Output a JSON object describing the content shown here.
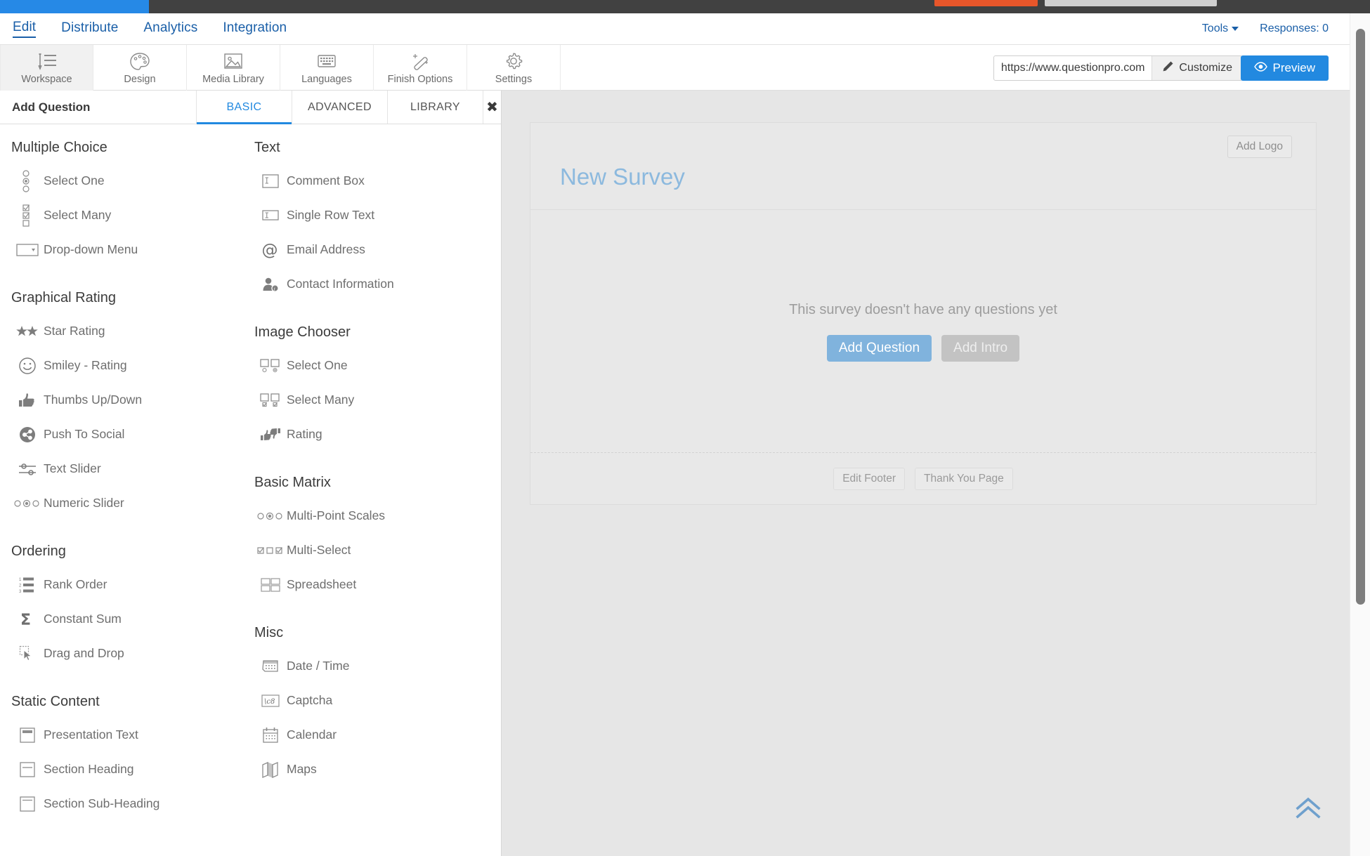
{
  "nav": {
    "tabs": [
      {
        "label": "Edit",
        "active": true
      },
      {
        "label": "Distribute",
        "active": false
      },
      {
        "label": "Analytics",
        "active": false
      },
      {
        "label": "Integration",
        "active": false
      }
    ],
    "tools_label": "Tools",
    "responses_label": "Responses: 0"
  },
  "toolbar": {
    "items": [
      {
        "label": "Workspace",
        "icon": "workspace-icon",
        "active": true
      },
      {
        "label": "Design",
        "icon": "palette-icon",
        "active": false
      },
      {
        "label": "Media Library",
        "icon": "image-icon",
        "active": false
      },
      {
        "label": "Languages",
        "icon": "keyboard-icon",
        "active": false
      },
      {
        "label": "Finish Options",
        "icon": "magic-wand-icon",
        "active": false
      },
      {
        "label": "Settings",
        "icon": "gear-icon",
        "active": false
      }
    ],
    "url_value": "https://www.questionpro.com",
    "customize_label": "Customize",
    "preview_label": "Preview"
  },
  "question_panel": {
    "title": "Add Question",
    "tabs": [
      {
        "label": "BASIC",
        "active": true
      },
      {
        "label": "ADVANCED",
        "active": false
      },
      {
        "label": "LIBRARY",
        "active": false
      }
    ],
    "close_label": "✖",
    "left_groups": [
      {
        "title": "Multiple Choice",
        "items": [
          {
            "label": "Select One",
            "icon": "radio-list-icon"
          },
          {
            "label": "Select Many",
            "icon": "checkbox-list-icon"
          },
          {
            "label": "Drop-down Menu",
            "icon": "dropdown-icon"
          }
        ]
      },
      {
        "title": "Graphical Rating",
        "items": [
          {
            "label": "Star Rating",
            "icon": "star-icon"
          },
          {
            "label": "Smiley - Rating",
            "icon": "smiley-icon"
          },
          {
            "label": "Thumbs Up/Down",
            "icon": "thumbs-up-icon"
          },
          {
            "label": "Push To Social",
            "icon": "share-icon"
          },
          {
            "label": "Text Slider",
            "icon": "sliders-icon"
          },
          {
            "label": "Numeric Slider",
            "icon": "numeric-slider-icon"
          }
        ]
      },
      {
        "title": "Ordering",
        "items": [
          {
            "label": "Rank Order",
            "icon": "ranked-list-icon"
          },
          {
            "label": "Constant Sum",
            "icon": "sigma-icon"
          },
          {
            "label": "Drag and Drop",
            "icon": "drag-drop-icon"
          }
        ]
      },
      {
        "title": "Static Content",
        "items": [
          {
            "label": "Presentation Text",
            "icon": "presentation-text-icon"
          },
          {
            "label": "Section Heading",
            "icon": "section-heading-icon"
          },
          {
            "label": "Section Sub-Heading",
            "icon": "section-subheading-icon"
          }
        ]
      }
    ],
    "right_groups": [
      {
        "title": "Text",
        "items": [
          {
            "label": "Comment Box",
            "icon": "comment-box-icon"
          },
          {
            "label": "Single Row Text",
            "icon": "single-row-text-icon"
          },
          {
            "label": "Email Address",
            "icon": "at-sign-icon"
          },
          {
            "label": "Contact Information",
            "icon": "contact-info-icon"
          }
        ]
      },
      {
        "title": "Image Chooser",
        "items": [
          {
            "label": "Select One",
            "icon": "image-radio-icon"
          },
          {
            "label": "Select Many",
            "icon": "image-checkbox-icon"
          },
          {
            "label": "Rating",
            "icon": "thumbs-rating-icon"
          }
        ]
      },
      {
        "title": "Basic Matrix",
        "items": [
          {
            "label": "Multi-Point Scales",
            "icon": "multipoint-scale-icon"
          },
          {
            "label": "Multi-Select",
            "icon": "multi-select-icon"
          },
          {
            "label": "Spreadsheet",
            "icon": "spreadsheet-icon"
          }
        ]
      },
      {
        "title": "Misc",
        "items": [
          {
            "label": "Date / Time",
            "icon": "date-time-icon"
          },
          {
            "label": "Captcha",
            "icon": "captcha-icon"
          },
          {
            "label": "Calendar",
            "icon": "calendar-icon"
          },
          {
            "label": "Maps",
            "icon": "map-icon"
          }
        ]
      }
    ]
  },
  "canvas": {
    "add_logo_label": "Add Logo",
    "survey_title": "New Survey",
    "empty_message": "This survey doesn't have any questions yet",
    "add_question_label": "Add Question",
    "add_intro_label": "Add Intro",
    "edit_footer_label": "Edit Footer",
    "thank_you_label": "Thank You Page"
  },
  "colors": {
    "accent_blue": "#2289e0",
    "nav_link_blue": "#1a5fa8",
    "title_blue": "#8cb9de",
    "browser_orange": "#e8562a"
  }
}
